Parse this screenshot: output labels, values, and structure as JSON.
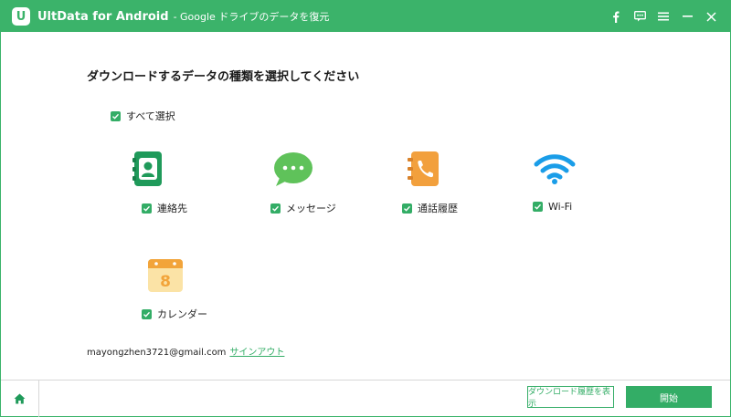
{
  "titlebar": {
    "logo_letter": "U",
    "app_name": "UltData for Android",
    "subtitle": "- Google ドライブのデータを復元"
  },
  "main": {
    "heading": "ダウンロードするデータの種類を選択してください",
    "select_all_label": "すべて選択",
    "items": [
      {
        "label": "連絡先",
        "icon": "contacts-icon",
        "checked": true
      },
      {
        "label": "メッセージ",
        "icon": "message-icon",
        "checked": true
      },
      {
        "label": "通話履歴",
        "icon": "call-log-icon",
        "checked": true
      },
      {
        "label": "Wi-Fi",
        "icon": "wifi-icon",
        "checked": true
      },
      {
        "label": "カレンダー",
        "icon": "calendar-icon",
        "checked": true,
        "day": "8"
      }
    ],
    "email": "mayongzhen3721@gmail.com",
    "signout_label": "サインアウト"
  },
  "footer": {
    "history_button": "ダウンロード履歴を表示",
    "start_button": "開始"
  },
  "colors": {
    "accent": "#3bb36a",
    "checkbox": "#33ad66"
  }
}
